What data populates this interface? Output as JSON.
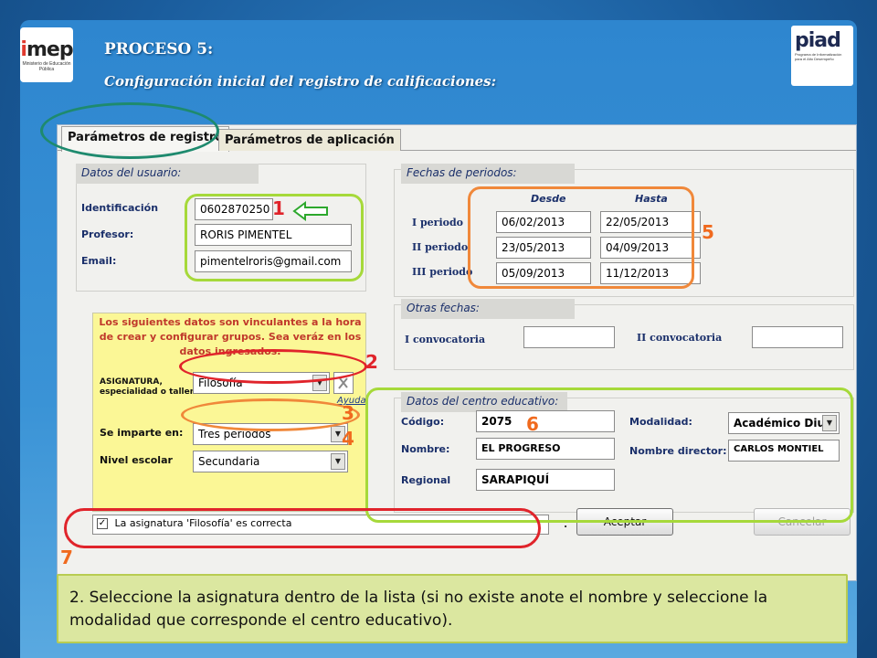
{
  "header": {
    "title": "PROCESO 5:",
    "subtitle": "Configuración inicial del registro de calificaciones:",
    "logo_left": "mep",
    "logo_left_caption": "Ministerio de Educación Pública",
    "logo_right": "piad",
    "logo_right_caption": "Programa de Informatización para el Alto Desempeño"
  },
  "tabs": [
    {
      "label": "Parámetros de registro",
      "active": true
    },
    {
      "label": "Parámetros de aplicación",
      "active": false
    }
  ],
  "usuario": {
    "group_label": "Datos del usuario:",
    "id_label": "Identificación",
    "id_value": "0602870250",
    "profesor_label": "Profesor:",
    "profesor_value": "RORIS PIMENTEL",
    "email_label": "Email:",
    "email_value": "pimentelroris@gmail.com"
  },
  "warning_text": "Los siguientes datos son vinculantes a la hora de crear y configurar grupos. Sea veráz en los datos ingresados.",
  "asignatura": {
    "label": "ASIGNATURA, especialidad o taller:",
    "value": "Filosofía",
    "help": "Ayuda",
    "imparte_label": "Se imparte en:",
    "imparte_value": "Tres periodos",
    "nivel_label": "Nivel escolar",
    "nivel_value": "Secundaria"
  },
  "periodos": {
    "group_label": "Fechas de periodos:",
    "desde": "Desde",
    "hasta": "Hasta",
    "rows": [
      {
        "label": "I periodo",
        "desde": "06/02/2013",
        "hasta": "22/05/2013"
      },
      {
        "label": "II periodo",
        "desde": "23/05/2013",
        "hasta": "04/09/2013"
      },
      {
        "label": "III periodo",
        "desde": "05/09/2013",
        "hasta": "11/12/2013"
      }
    ]
  },
  "otras_fechas": {
    "group_label": "Otras fechas:",
    "i_label": "I convocatoria",
    "i_value": "",
    "ii_label": "II convocatoria",
    "ii_value": ""
  },
  "centro": {
    "group_label": "Datos del centro educativo:",
    "codigo_label": "Código:",
    "codigo_value": "2075",
    "nombre_label": "Nombre:",
    "nombre_value": "EL PROGRESO",
    "regional_label": "Regional",
    "regional_value": "SARAPIQUÍ",
    "modalidad_label": "Modalidad:",
    "modalidad_value": "Académico Diur",
    "director_label": "Nombre director:",
    "director_value": "CARLOS MONTIEL"
  },
  "confirm": {
    "checkbox_label": "La asignatura 'Filosofía' es correcta",
    "checked": true,
    "dot": ".",
    "accept": "Aceptar",
    "cancel": "Cancelar"
  },
  "markers": [
    "1",
    "2",
    "3",
    "4",
    "5",
    "6",
    "7"
  ],
  "caption": "2. Seleccione la asignatura dentro de la lista (si no existe anote el nombre y seleccione la modalidad que corresponde el centro educativo).",
  "colors": {
    "green_ring": "#a6d93a",
    "red_ring": "#e0242b",
    "orange_ring": "#f0883a",
    "teal_ring": "#1e8a6e",
    "number_red": "#e0242b",
    "number_orange": "#f06a1e"
  },
  "icons": {
    "arrow": "left-arrow-icon",
    "checkbox": "checkbox-icon",
    "dropdown": "chevron-down-icon",
    "help": "help-icon"
  }
}
